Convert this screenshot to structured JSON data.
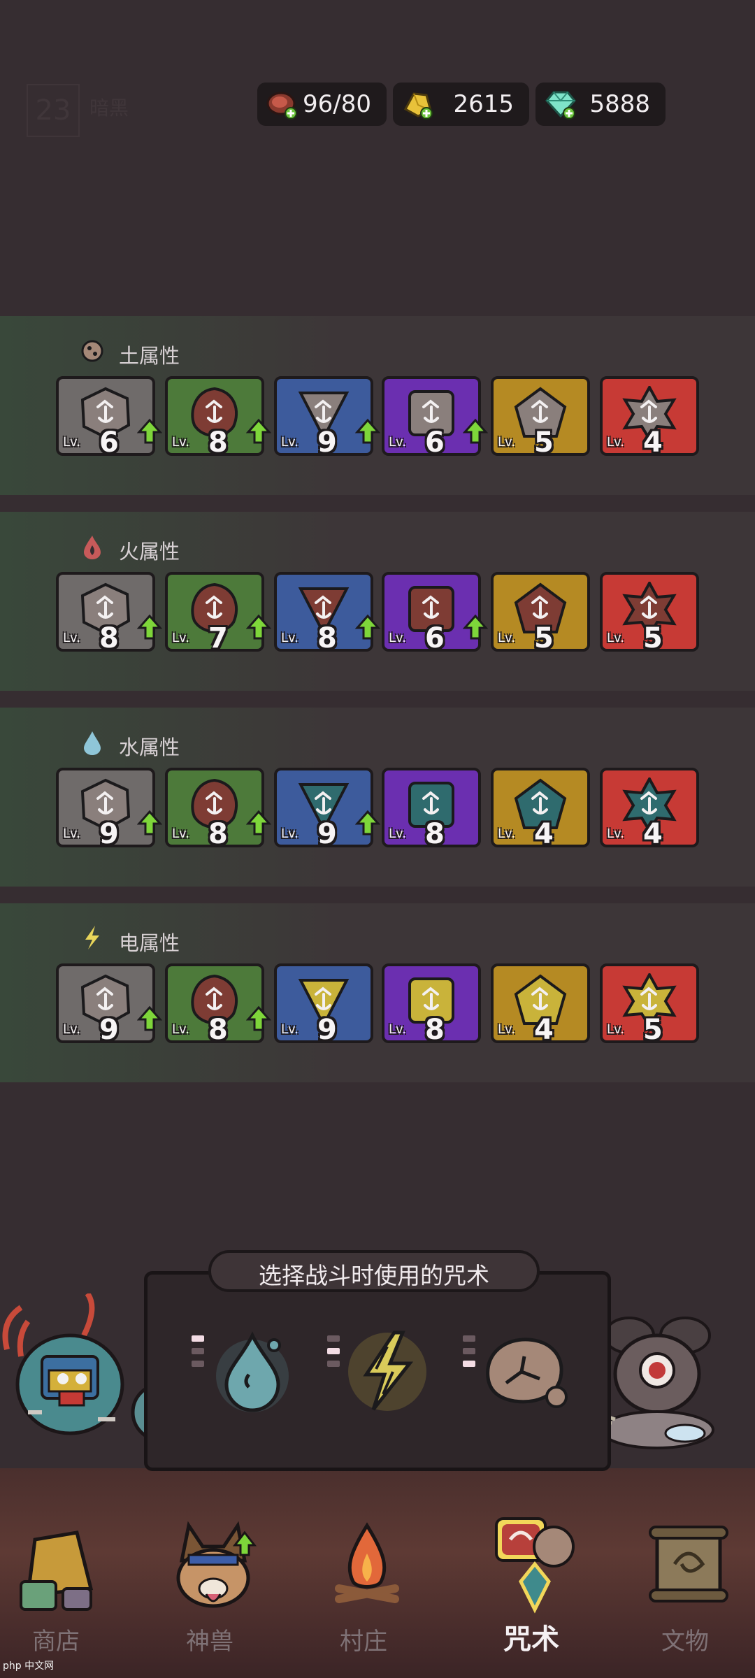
{
  "header": {
    "level": "23",
    "level_text": "暗黑",
    "meat": "96/80",
    "gold": "2615",
    "gems": "5888"
  },
  "sections": [
    {
      "title": "土属性",
      "cards": [
        {
          "lv": "Lv.",
          "level": "6",
          "upgrade": true
        },
        {
          "lv": "Lv.",
          "level": "8",
          "upgrade": true
        },
        {
          "lv": "Lv.",
          "level": "9",
          "upgrade": true
        },
        {
          "lv": "Lv.",
          "level": "6",
          "upgrade": true
        },
        {
          "lv": "Lv.",
          "level": "5",
          "upgrade": false
        },
        {
          "lv": "Lv.",
          "level": "4",
          "upgrade": false
        }
      ]
    },
    {
      "title": "火属性",
      "cards": [
        {
          "lv": "Lv.",
          "level": "8",
          "upgrade": true
        },
        {
          "lv": "Lv.",
          "level": "7",
          "upgrade": true
        },
        {
          "lv": "Lv.",
          "level": "8",
          "upgrade": true
        },
        {
          "lv": "Lv.",
          "level": "6",
          "upgrade": true
        },
        {
          "lv": "Lv.",
          "level": "5",
          "upgrade": false
        },
        {
          "lv": "Lv.",
          "level": "5",
          "upgrade": false
        }
      ]
    },
    {
      "title": "水属性",
      "cards": [
        {
          "lv": "Lv.",
          "level": "9",
          "upgrade": true
        },
        {
          "lv": "Lv.",
          "level": "8",
          "upgrade": true
        },
        {
          "lv": "Lv.",
          "level": "9",
          "upgrade": true
        },
        {
          "lv": "Lv.",
          "level": "8",
          "upgrade": false
        },
        {
          "lv": "Lv.",
          "level": "4",
          "upgrade": false
        },
        {
          "lv": "Lv.",
          "level": "4",
          "upgrade": false
        }
      ]
    },
    {
      "title": "电属性",
      "cards": [
        {
          "lv": "Lv.",
          "level": "9",
          "upgrade": true
        },
        {
          "lv": "Lv.",
          "level": "8",
          "upgrade": true
        },
        {
          "lv": "Lv.",
          "level": "9",
          "upgrade": false
        },
        {
          "lv": "Lv.",
          "level": "8",
          "upgrade": false
        },
        {
          "lv": "Lv.",
          "level": "4",
          "upgrade": false
        },
        {
          "lv": "Lv.",
          "level": "5",
          "upgrade": false
        }
      ]
    }
  ],
  "spell_panel": {
    "title": "选择战斗时使用的咒术",
    "slots": [
      {
        "icon": "water-drop-icon",
        "pips": [
          true,
          false,
          false
        ]
      },
      {
        "icon": "lightning-icon",
        "pips": [
          false,
          true,
          false
        ]
      },
      {
        "icon": "rock-icon",
        "pips": [
          false,
          false,
          true
        ]
      }
    ]
  },
  "nav": {
    "items": [
      {
        "label": "商店",
        "icon": "shop-icon"
      },
      {
        "label": "神兽",
        "icon": "beast-icon"
      },
      {
        "label": "村庄",
        "icon": "campfire-icon"
      },
      {
        "label": "咒术",
        "icon": "spell-icon"
      },
      {
        "label": "文物",
        "icon": "scroll-icon"
      }
    ],
    "active_index": 3
  },
  "watermark": "php 中文网",
  "colors": {
    "background": "#362d31",
    "upgrade_arrow": "#7ed63a",
    "rarity": [
      "#6f6b6a",
      "#4d7a3a",
      "#3d5b9c",
      "#6b2fb0",
      "#b58a23",
      "#c73a35"
    ]
  }
}
